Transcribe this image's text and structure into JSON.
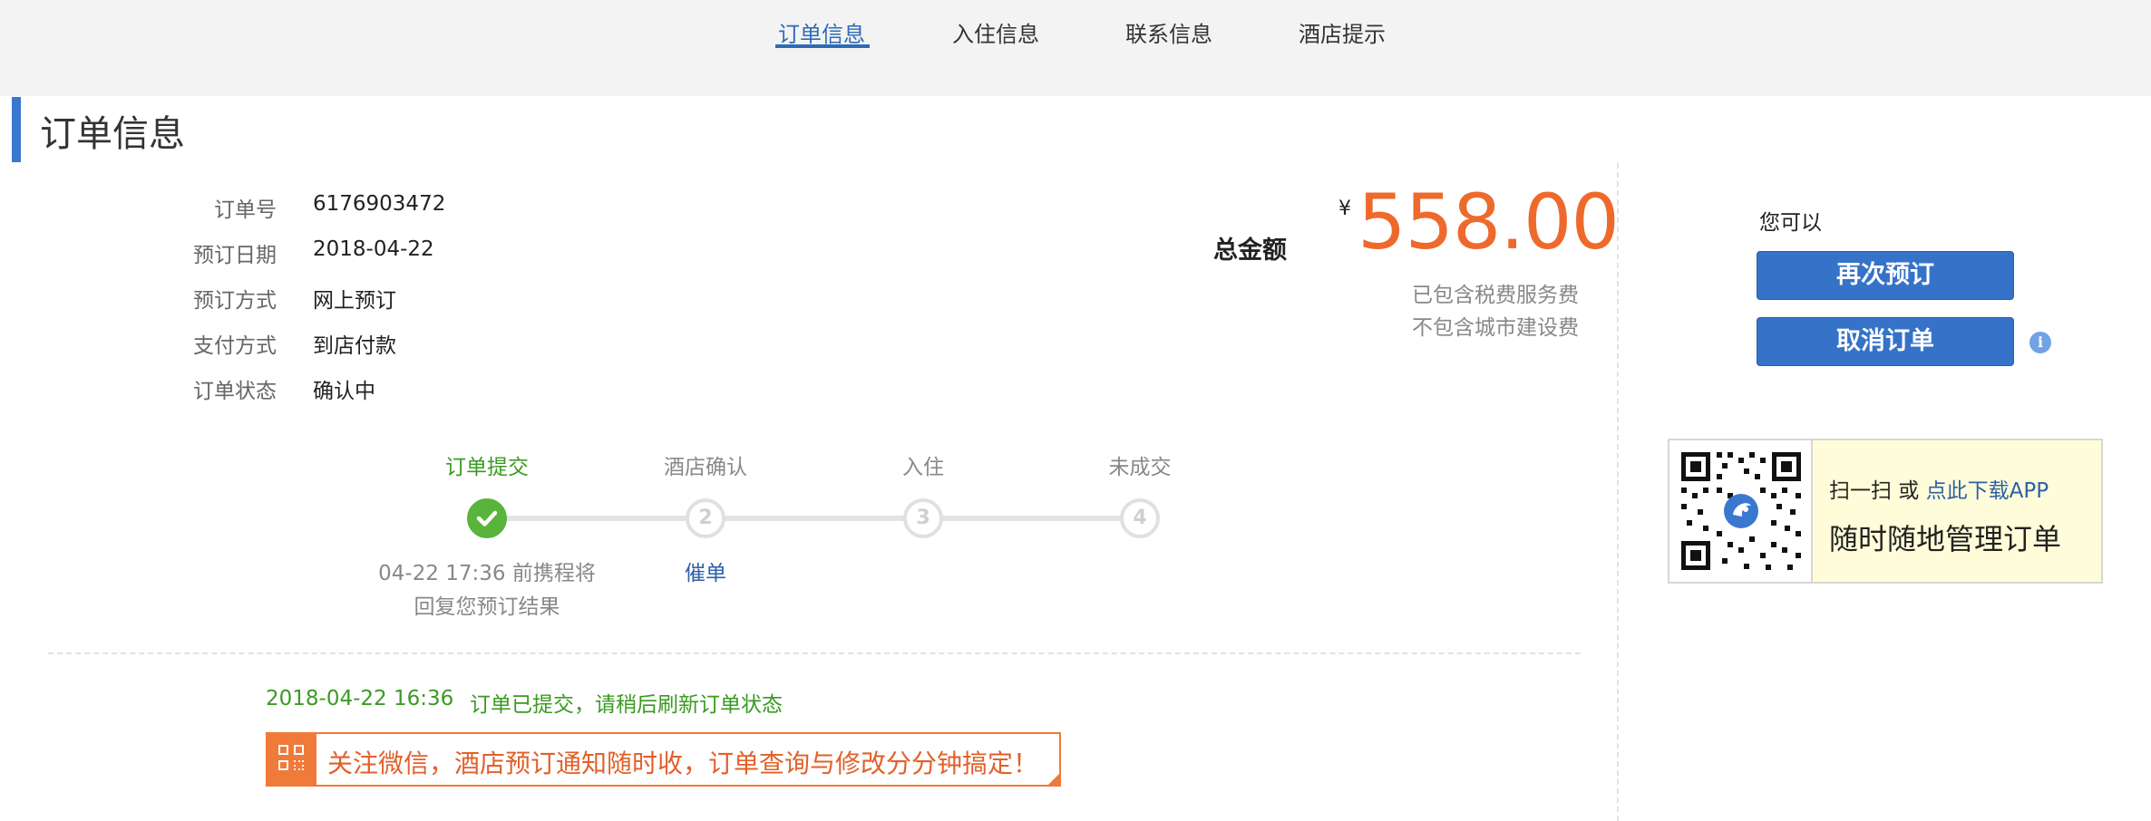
{
  "tabs": [
    {
      "label": "订单信息",
      "active": true
    },
    {
      "label": "入住信息",
      "active": false
    },
    {
      "label": "联系信息",
      "active": false
    },
    {
      "label": "酒店提示",
      "active": false
    }
  ],
  "section": {
    "title": "订单信息"
  },
  "order": {
    "rows": [
      {
        "label": "订单号",
        "value": "6176903472"
      },
      {
        "label": "预订日期",
        "value": "2018-04-22"
      },
      {
        "label": "预订方式",
        "value": "网上预订"
      },
      {
        "label": "支付方式",
        "value": "到店付款"
      },
      {
        "label": "订单状态",
        "value": "确认中"
      }
    ]
  },
  "total": {
    "label": "总金额",
    "currency": "¥",
    "amount": "558.00",
    "note1": "已包含税费服务费",
    "note2": "不包含城市建设费"
  },
  "progress": {
    "steps": [
      {
        "label": "订单提交",
        "number": "",
        "done": true
      },
      {
        "label": "酒店确认",
        "number": "2",
        "done": false
      },
      {
        "label": "入住",
        "number": "3",
        "done": false
      },
      {
        "label": "未成交",
        "number": "4",
        "done": false
      }
    ],
    "step1_desc_line1": "04-22 17:36 前携程将",
    "step1_desc_line2": "回复您预订结果",
    "urge_label": "催单"
  },
  "log": {
    "time": "2018-04-22 16:36",
    "text": "订单已提交，请稍后刷新订单状态"
  },
  "promo": {
    "text": "关注微信，酒店预订通知随时收，订单查询与修改分分钟搞定！"
  },
  "actions": {
    "you_can": "您可以",
    "rebook_label": "再次预订",
    "cancel_label": "取消订单",
    "info_icon": "i"
  },
  "app": {
    "scan_prefix": "扫一扫 或 ",
    "download_link": "点此下载APP",
    "manage_text": "随时随地管理订单"
  },
  "colors": {
    "accent_blue": "#3572c8",
    "amount_orange": "#ee6a2c",
    "success_green": "#3b9a22"
  }
}
